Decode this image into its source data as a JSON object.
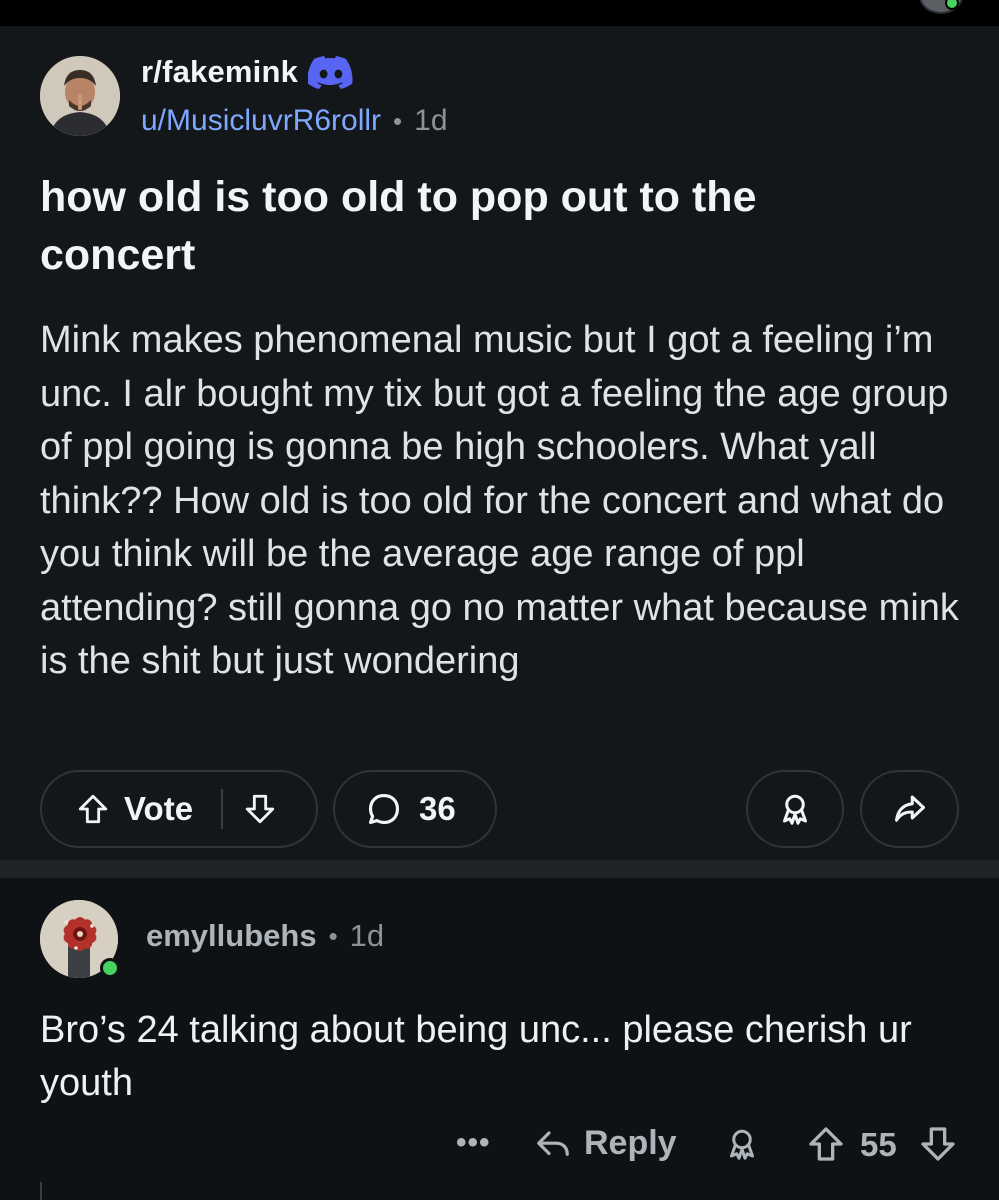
{
  "post": {
    "subreddit": "r/fakemink",
    "author": "u/MusicluvrR6rollr",
    "separator": "•",
    "age": "1d",
    "title": "how old is too old to pop out to the concert",
    "body": "Mink makes phenomenal music but I got a feeling i’m unc. I alr bought my tix but got a feeling the age group of ppl going is gonna be high schoolers. What yall think?? How old is too old for the concert and what do you think will be the average age range of ppl attending? still gonna go no matter what because mink is the shit but just wondering"
  },
  "actions": {
    "vote_label": "Vote",
    "comment_count": "36"
  },
  "comment": {
    "author": "emyllubehs",
    "separator": "•",
    "age": "1d",
    "body": "Bro’s 24 talking about being unc... please cherish ur youth",
    "more_label": "•••",
    "reply_label": "Reply",
    "score": "55"
  },
  "colors": {
    "background": "#0e1113",
    "post_background": "#141719",
    "author_link": "#7ea8ff",
    "discord_brand": "#5865F2",
    "online_status": "#46d160"
  },
  "icons": {
    "upvote": "arrow-up-icon",
    "downvote": "arrow-down-icon",
    "comment": "speech-bubble-icon",
    "award": "award-icon",
    "share": "share-arrow-icon",
    "reply": "reply-arrow-icon",
    "discord": "discord-icon"
  }
}
